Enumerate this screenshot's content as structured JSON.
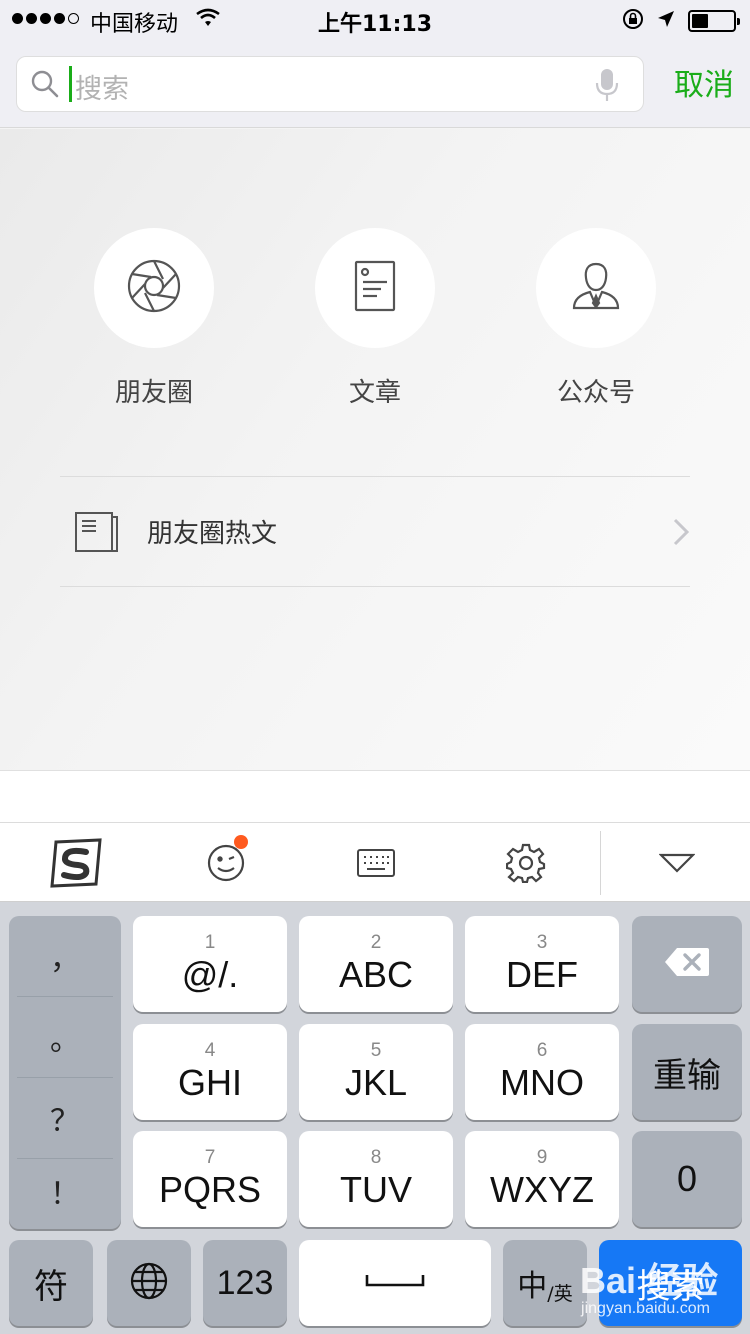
{
  "status_bar": {
    "carrier": "中国移动",
    "time": "上午11:13",
    "battery_level": 0.4
  },
  "search": {
    "placeholder": "搜索",
    "cancel_label": "取消"
  },
  "categories": [
    {
      "label": "朋友圈",
      "icon": "camera-shutter-icon"
    },
    {
      "label": "文章",
      "icon": "document-icon"
    },
    {
      "label": "公众号",
      "icon": "person-icon"
    }
  ],
  "hot_articles": {
    "label": "朋友圈热文"
  },
  "keyboard": {
    "punctuation": [
      "，",
      "。",
      "？",
      "！"
    ],
    "rows": [
      [
        {
          "num": "1",
          "letters": "@/."
        },
        {
          "num": "2",
          "letters": "ABC"
        },
        {
          "num": "3",
          "letters": "DEF"
        }
      ],
      [
        {
          "num": "4",
          "letters": "GHI"
        },
        {
          "num": "5",
          "letters": "JKL"
        },
        {
          "num": "6",
          "letters": "MNO"
        }
      ],
      [
        {
          "num": "7",
          "letters": "PQRS"
        },
        {
          "num": "8",
          "letters": "TUV"
        },
        {
          "num": "9",
          "letters": "WXYZ"
        }
      ]
    ],
    "retype_label": "重输",
    "zero_label": "0",
    "symbol_label": "符",
    "number_label": "123",
    "lang_main": "中",
    "lang_sub": "/英",
    "search_label": "搜索"
  },
  "watermark": {
    "text": "Bai 经验",
    "sub": "jingyan.baidu.com"
  },
  "colors": {
    "accent": "#1aad19",
    "search_key": "#1678f5",
    "notification_dot": "#ff5a1f"
  }
}
